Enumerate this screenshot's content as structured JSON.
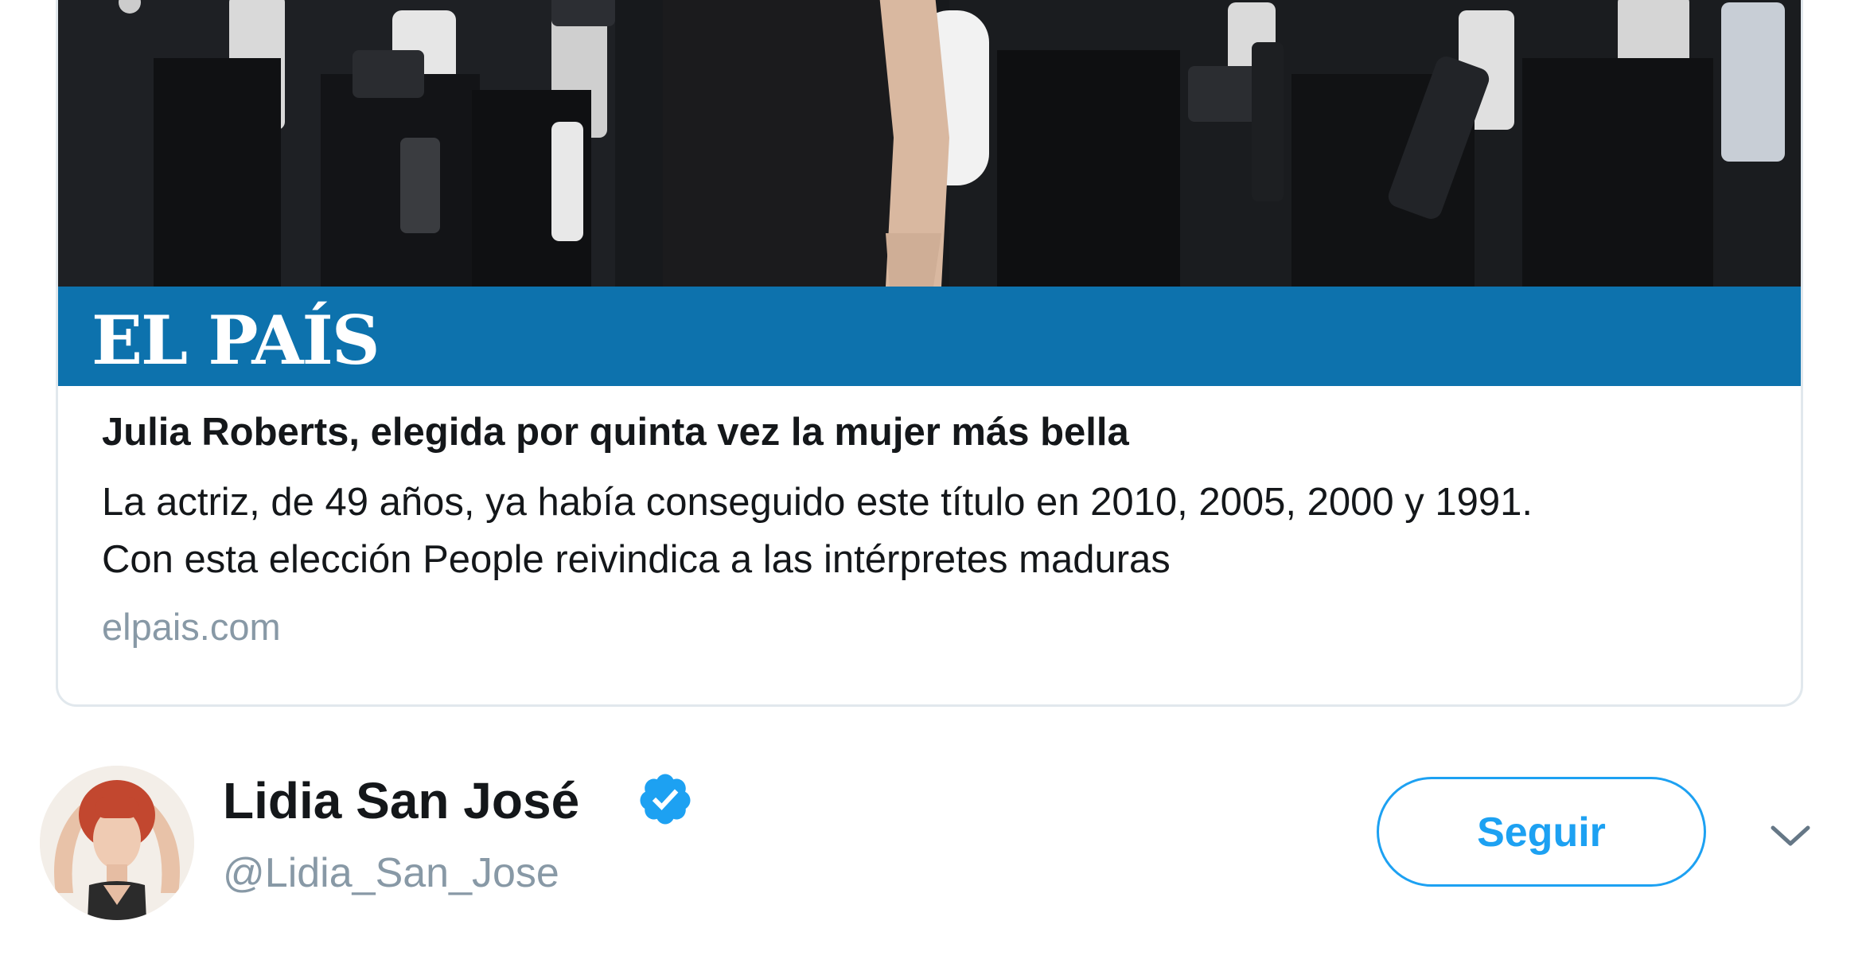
{
  "card": {
    "image_alt": "Julia Roberts on red carpet with photographers",
    "brand": "EL PAÍS",
    "title": "Julia Roberts, elegida por quinta vez la mujer más bella",
    "description_line1": "La actriz, de 49 años, ya había conseguido este título en 2010, 2005, 2000 y 1991.",
    "description_line2": "Con esta elección People reivindica a las intérpretes maduras",
    "domain": "elpais.com",
    "brand_color": "#0d72ad"
  },
  "tweet_header": {
    "display_name": "Lidia San José",
    "verified": true,
    "handle": "@Lidia_San_Jose",
    "follow_label": "Seguir",
    "accent_color": "#1da1f2",
    "icons": [
      "verified-badge-icon",
      "chevron-down-icon"
    ]
  }
}
